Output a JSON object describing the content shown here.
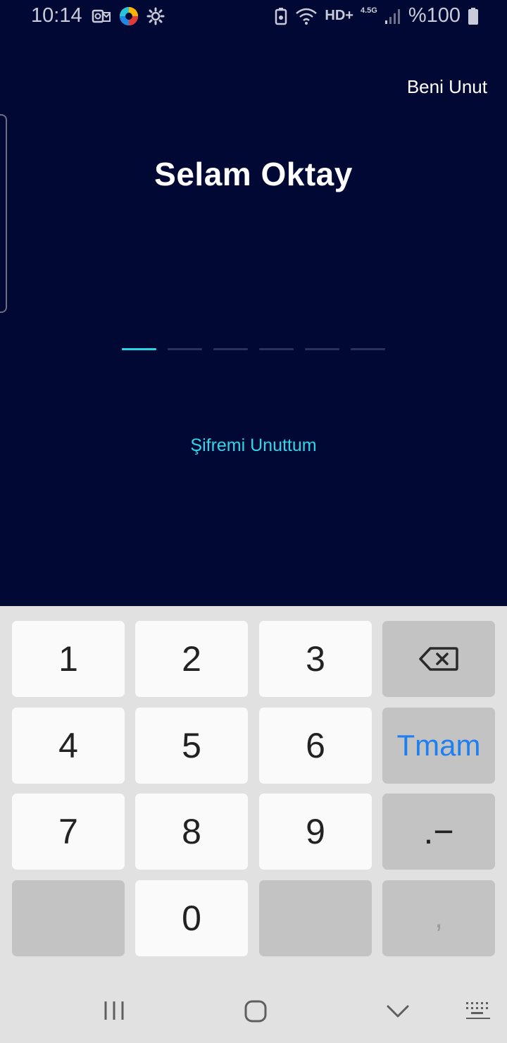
{
  "status_bar": {
    "time": "10:14",
    "network": "HD+",
    "network_type": "4.5G",
    "battery": "%100"
  },
  "header": {
    "forget_me": "Beni Unut"
  },
  "main": {
    "greeting": "Selam Oktay",
    "pin_length": 6,
    "pin_entered": 0,
    "forgot_password": "Şifremi Unuttum"
  },
  "keyboard": {
    "rows": [
      [
        "1",
        "2",
        "3",
        "backspace"
      ],
      [
        "4",
        "5",
        "6",
        "Tmam"
      ],
      [
        "7",
        "8",
        "9",
        ".−"
      ],
      [
        "",
        "0",
        "",
        ","
      ]
    ],
    "k1": "1",
    "k2": "2",
    "k3": "3",
    "k4": "4",
    "k5": "5",
    "k6": "6",
    "k7": "7",
    "k8": "8",
    "k9": "9",
    "k0": "0",
    "done": "Tmam",
    "dot_minus": ".−",
    "comma": ","
  },
  "colors": {
    "background": "#000833",
    "accent": "#27d4e6",
    "done_blue": "#1e7ff0"
  }
}
